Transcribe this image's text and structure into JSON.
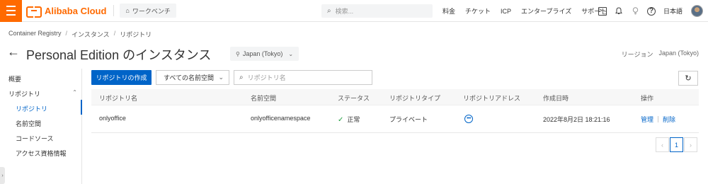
{
  "topbar": {
    "brand": "Alibaba Cloud",
    "workbench": "ワークベンチ",
    "search_placeholder": "検索...",
    "links": [
      "料金",
      "チケット",
      "ICP",
      "エンタープライズ",
      "サポート"
    ],
    "language": "日本語"
  },
  "breadcrumb": [
    "Container Registry",
    "インスタンス",
    "リポジトリ"
  ],
  "header": {
    "title": "Personal Edition のインスタンス",
    "region": "Japan (Tokyo)",
    "region_label": "リージョン",
    "region_value": "Japan (Tokyo)"
  },
  "sidebar": {
    "overview": "概要",
    "group": "リポジトリ",
    "items": [
      "リポジトリ",
      "名前空間",
      "コードソース",
      "アクセス資格情報"
    ]
  },
  "toolbar": {
    "create_label": "リポジトリの作成",
    "namespace_select": "すべての名前空間",
    "search_placeholder": "リポジトリ名"
  },
  "table": {
    "columns": [
      "リポジトリ名",
      "名前空間",
      "ステータス",
      "リポジトリタイプ",
      "リポジトリアドレス",
      "作成日時",
      "操作"
    ],
    "rows": [
      {
        "name": "onlyoffice",
        "namespace": "onlyofficenamespace",
        "status": "正常",
        "type": "プライベート",
        "address": "•••",
        "created": "2022年8月2日 18:21:16",
        "actions": [
          "管理",
          "削除"
        ]
      }
    ]
  },
  "pagination": {
    "current": "1"
  },
  "colors": {
    "brand": "#ff6a00",
    "primary": "#0064c8",
    "success": "#1e9e3e"
  }
}
